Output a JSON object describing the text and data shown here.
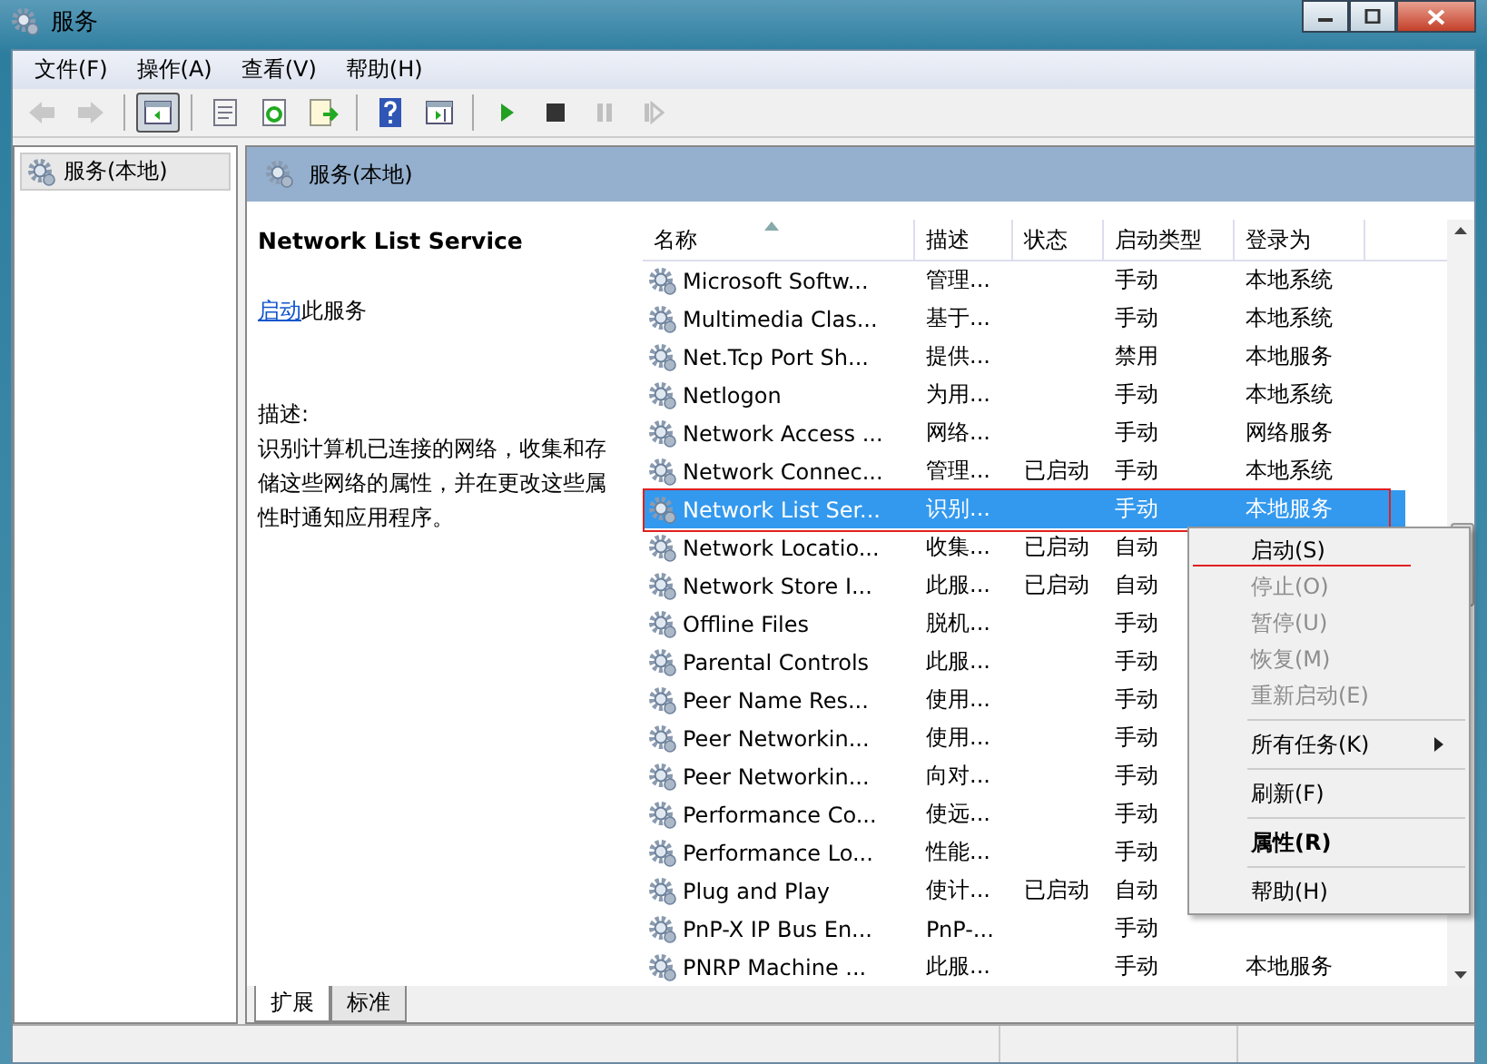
{
  "window": {
    "title": "服务"
  },
  "menu": [
    "文件(F)",
    "操作(A)",
    "查看(V)",
    "帮助(H)"
  ],
  "toolbar": [
    {
      "kind": "back",
      "disabled": true,
      "pressed": false
    },
    {
      "kind": "forward",
      "disabled": true,
      "pressed": false
    },
    {
      "kind": "separator"
    },
    {
      "kind": "console-tree",
      "disabled": false,
      "pressed": true
    },
    {
      "kind": "separator"
    },
    {
      "kind": "properties",
      "disabled": false,
      "pressed": false
    },
    {
      "kind": "refresh",
      "disabled": false,
      "pressed": false
    },
    {
      "kind": "export",
      "disabled": false,
      "pressed": false
    },
    {
      "kind": "separator"
    },
    {
      "kind": "help",
      "disabled": false,
      "pressed": false
    },
    {
      "kind": "action-pane",
      "disabled": false,
      "pressed": false
    },
    {
      "kind": "separator"
    },
    {
      "kind": "play",
      "disabled": false,
      "pressed": false
    },
    {
      "kind": "stop",
      "disabled": false,
      "pressed": false
    },
    {
      "kind": "pause",
      "disabled": true,
      "pressed": false
    },
    {
      "kind": "resume",
      "disabled": true,
      "pressed": false
    }
  ],
  "tree": {
    "items": [
      {
        "label": "服务(本地)",
        "selected": true
      }
    ]
  },
  "panel": {
    "title": "服务(本地)"
  },
  "details": {
    "service_name": "Network List Service",
    "action_link": "启动",
    "action_text": "此服务",
    "description_label": "描述:",
    "description": "识别计算机已连接的网络，收集和存储这些网络的属性，并在更改这些属性时通知应用程序。"
  },
  "table": {
    "columns": [
      {
        "label": "名称",
        "sorted": true
      },
      {
        "label": "描述",
        "sorted": false
      },
      {
        "label": "状态",
        "sorted": false
      },
      {
        "label": "启动类型",
        "sorted": false
      },
      {
        "label": "登录为",
        "sorted": false
      }
    ],
    "rows": [
      {
        "name": "Microsoft Softw...",
        "description": "管理...",
        "startup": "手动",
        "logon": "本地系统",
        "selected": false
      },
      {
        "name": "Multimedia Clas...",
        "description": "基于...",
        "startup": "手动",
        "logon": "本地系统",
        "selected": false
      },
      {
        "name": "Net.Tcp Port Sh...",
        "description": "提供...",
        "startup": "禁用",
        "logon": "本地服务",
        "selected": false
      },
      {
        "name": "Netlogon",
        "description": "为用...",
        "startup": "手动",
        "logon": "本地系统",
        "selected": false
      },
      {
        "name": "Network Access ...",
        "description": "网络...",
        "startup": "手动",
        "logon": "网络服务",
        "selected": false
      },
      {
        "name": "Network Connec...",
        "description": "管理...",
        "status": "已启动",
        "startup": "手动",
        "logon": "本地系统",
        "selected": false
      },
      {
        "name": "Network List Ser...",
        "description": "识别...",
        "startup": "手动",
        "logon": "本地服务",
        "selected": true
      },
      {
        "name": "Network Locatio...",
        "description": "收集...",
        "status": "已启动",
        "startup": "自动",
        "selected": false
      },
      {
        "name": "Network Store I...",
        "description": "此服...",
        "status": "已启动",
        "startup": "自动",
        "selected": false
      },
      {
        "name": "Offline Files",
        "description": "脱机...",
        "startup": "手动",
        "selected": false
      },
      {
        "name": "Parental Controls",
        "description": "此服...",
        "startup": "手动",
        "selected": false
      },
      {
        "name": "Peer Name Res...",
        "description": "使用...",
        "startup": "手动",
        "selected": false
      },
      {
        "name": "Peer Networkin...",
        "description": "使用...",
        "startup": "手动",
        "selected": false
      },
      {
        "name": "Peer Networkin...",
        "description": "向对...",
        "startup": "手动",
        "selected": false
      },
      {
        "name": "Performance Co...",
        "description": "使远...",
        "startup": "手动",
        "selected": false
      },
      {
        "name": "Performance Lo...",
        "description": "性能...",
        "startup": "手动",
        "selected": false
      },
      {
        "name": "Plug and Play",
        "description": "使计...",
        "status": "已启动",
        "startup": "自动",
        "selected": false
      },
      {
        "name": "PnP-X IP Bus En...",
        "description": "PnP-...",
        "startup": "手动",
        "selected": false
      },
      {
        "name": "PNRP Machine ...",
        "description": "此服...",
        "startup": "手动",
        "logon": "本地服务",
        "selected": false
      }
    ]
  },
  "context_menu": [
    {
      "kind": "item",
      "label": "启动(S)",
      "disabled": false,
      "bold": false,
      "submenu": false
    },
    {
      "kind": "item",
      "label": "停止(O)",
      "disabled": true,
      "bold": false,
      "submenu": false
    },
    {
      "kind": "item",
      "label": "暂停(U)",
      "disabled": true,
      "bold": false,
      "submenu": false
    },
    {
      "kind": "item",
      "label": "恢复(M)",
      "disabled": true,
      "bold": false,
      "submenu": false
    },
    {
      "kind": "item",
      "label": "重新启动(E)",
      "disabled": true,
      "bold": false,
      "submenu": false
    },
    {
      "kind": "separator"
    },
    {
      "kind": "item",
      "label": "所有任务(K)",
      "disabled": false,
      "bold": false,
      "submenu": true
    },
    {
      "kind": "separator"
    },
    {
      "kind": "item",
      "label": "刷新(F)",
      "disabled": false,
      "bold": false,
      "submenu": false
    },
    {
      "kind": "separator"
    },
    {
      "kind": "item",
      "label": "属性(R)",
      "disabled": false,
      "bold": true,
      "submenu": false
    },
    {
      "kind": "separator"
    },
    {
      "kind": "item",
      "label": "帮助(H)",
      "disabled": false,
      "bold": false,
      "submenu": false
    }
  ],
  "view_tabs": [
    {
      "label": "扩展",
      "selected": true
    },
    {
      "label": "标准",
      "selected": false
    }
  ]
}
